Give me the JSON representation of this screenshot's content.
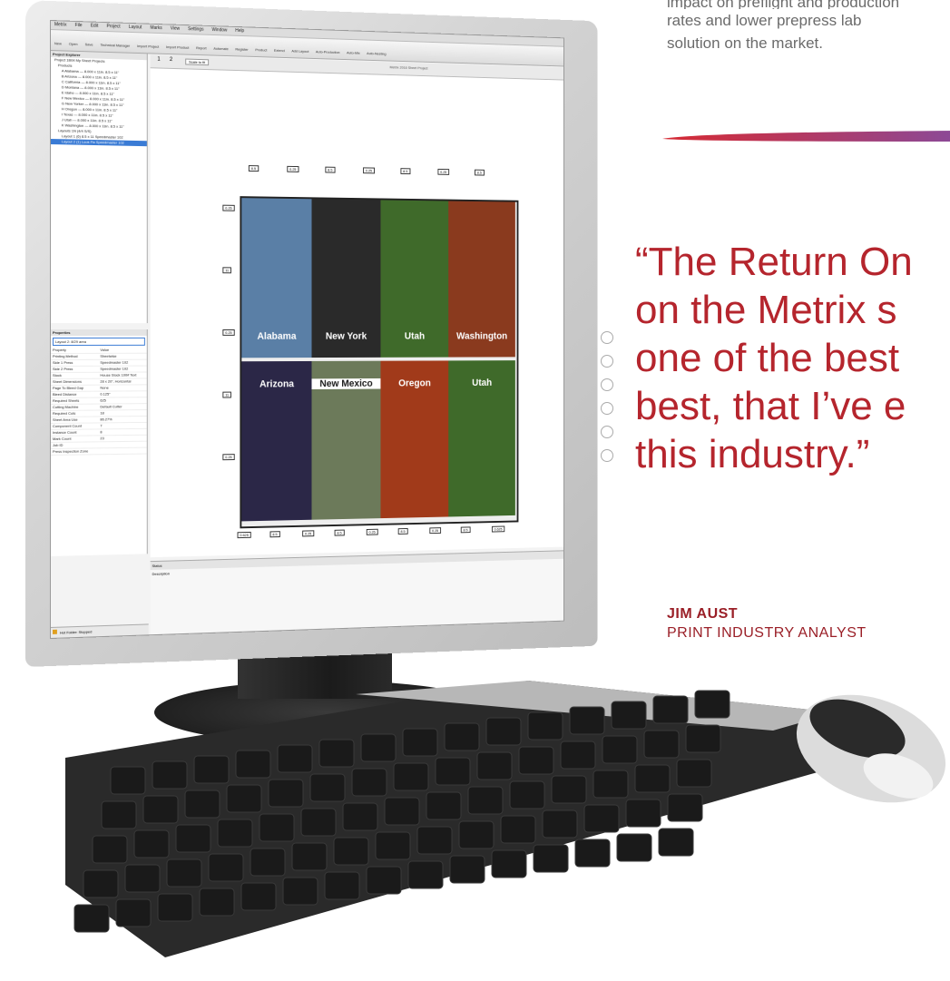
{
  "marketing": {
    "intro_lines": [
      "impact on preflight and production",
      "rates and lower prepress lab",
      "solution on the market."
    ],
    "quote_lines": [
      "“The Return On",
      " on the Metrix s",
      " one of the best",
      " best, that I’ve e",
      " this industry.”"
    ],
    "author_name": "JIM AUST",
    "author_title": "PRINT INDUSTRY ANALYST",
    "accent_color": "#b5252d"
  },
  "app": {
    "menu": [
      "Metrix",
      "File",
      "Edit",
      "Project",
      "Layout",
      "Marks",
      "View",
      "Settings",
      "Window",
      "Help"
    ],
    "toolbar": [
      "New",
      "Open",
      "Save",
      "Technical Manager",
      "Import Project",
      "Import Product",
      "Report",
      "Automate",
      "Register",
      "Product",
      "Extend",
      "Add Layout",
      "Auto-Production",
      "Auto-Mix",
      "Auto-Nesting"
    ],
    "explorer_title": "Project Explorer",
    "explorer_items": [
      "Project 1B04 My Sheet Projects",
      "Products",
      "A Alabama — 8.000 x 11in. 8.5 x 11\"",
      "B Arizona — 8.000 x 11in. 8.5 x 11\"",
      "C California — 8.000 x 11in. 8.5 x 11\"",
      "D Montana — 8.000 x 11in. 8.5 x 11\"",
      "E Idaho — 8.000 x 11in. 8.5 x 11\"",
      "F New Mexico — 8.000 x 11in. 8.5 x 11\"",
      "G New Yorker — 8.000 x 11in. 8.5 x 11\"",
      "H Oregon — 8.000 x 11in. 8.5 x 11\"",
      "I Texas — 8.000 x 11in. 8.5 x 11\"",
      "J Utah — 8.000 x 11in. 8.5 x 11\"",
      "K Washington — 8.000 x 11in. 8.5 x 11\"",
      "Layouts 1N (4/4 S/S)",
      "Layout 1 (6) 8.5 x 11 Speedmaster 102",
      "Layout 2 (1) Look Fix Speedmaster 102"
    ],
    "selected_item_index": 15,
    "properties_title": "Properties",
    "properties_dropdown": "Layout 2: 8/29 area",
    "properties_columns": [
      "Property",
      "Value"
    ],
    "properties_rows": [
      [
        "Printing Method",
        "Sheetwise"
      ],
      [
        "Side 1 Press",
        "Speedmaster 102"
      ],
      [
        "Side 2 Press",
        "Speedmaster 102"
      ],
      [
        "Stock",
        "House Stock 100# Text"
      ],
      [
        "Sheet Dimensions",
        "28 x 20\", Horizontal"
      ],
      [
        "Page To Bleed Gap",
        "None"
      ],
      [
        "Bleed Distance",
        "0.125\""
      ],
      [
        "Required Sheets",
        "625"
      ],
      [
        "Cutting Machine",
        "Default Cutter"
      ],
      [
        "Required Cuts",
        "18"
      ],
      [
        "Sheet Area Use",
        "86.27%"
      ],
      [
        "Component Count",
        "7"
      ],
      [
        "Instance Count",
        "8"
      ],
      [
        "Mark Count",
        "23"
      ],
      [
        "Job ID",
        ""
      ],
      [
        "Press Inspection Zone",
        ""
      ]
    ],
    "canvas_title": "Metrix 2016 Sheet Project",
    "page_tabs": [
      "1",
      "2"
    ],
    "zoom_label": "Scale to fit",
    "photos": [
      {
        "label": "Alabama",
        "bg": "#5a7fa6"
      },
      {
        "label": "New York",
        "bg": "#2a2a2a"
      },
      {
        "label": "Utah",
        "bg": "#3f6a2a"
      },
      {
        "label": "Washington",
        "bg": "#8a3a1e"
      },
      {
        "label": "Arizona",
        "bg": "#2b2747"
      },
      {
        "label": "New Mexico",
        "bg": "#6c7a5a"
      },
      {
        "label": "Oregon",
        "bg": "#a13a1a"
      },
      {
        "label": "Utah",
        "bg": "#3f6a2a"
      }
    ],
    "dimensions_top": [
      "8.5",
      "0.25",
      "8.5",
      "0.25",
      "8.5",
      "0.25",
      "8.5"
    ],
    "dimensions_bottom": [
      "0.625",
      "8.5",
      "0.25",
      "8.5",
      "0.25",
      "8.5",
      "0.25",
      "8.5",
      "0.625"
    ],
    "dimensions_side": [
      "0.25",
      "11",
      "0.25",
      "11",
      "0.25"
    ],
    "status_label": "Status",
    "description_label": "Description",
    "taskbar_label": "Hot Folder: Stopped"
  }
}
